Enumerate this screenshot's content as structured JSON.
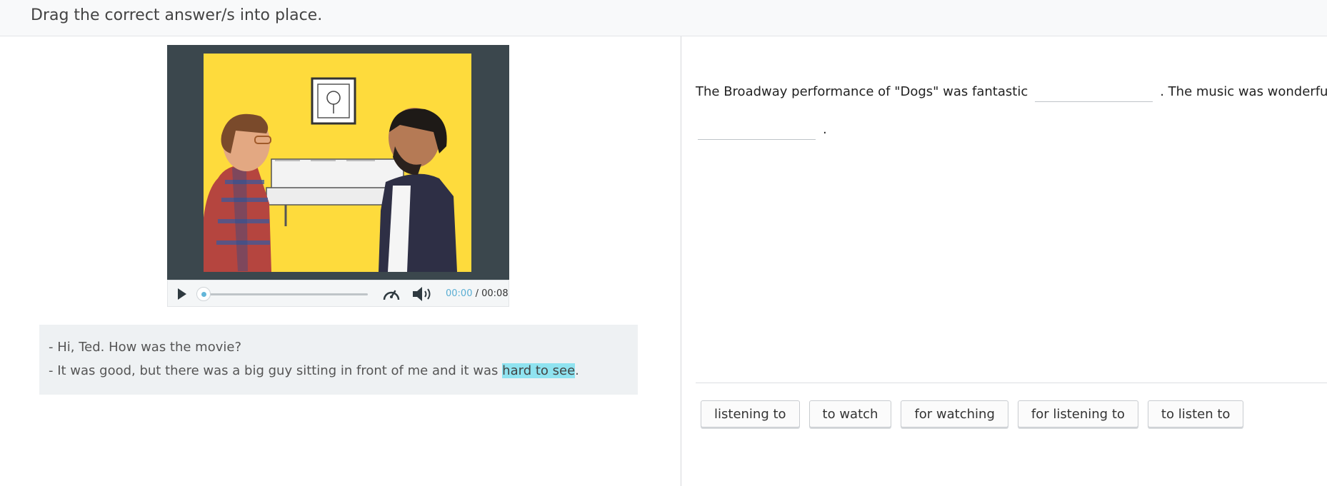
{
  "header": {
    "instruction": "Drag the correct answer/s into place."
  },
  "player": {
    "current_time": "00:00",
    "separator": " / ",
    "duration": "00:08",
    "progress": 0.0
  },
  "transcript": {
    "line1": "- Hi, Ted. How was the movie?",
    "line2_before": "- It was good, but there was a big guy sitting in front of me and it was ",
    "line2_highlight": "hard to see",
    "line2_after": "."
  },
  "question": {
    "part1": "The Broadway performance of \"Dogs\" was fantastic",
    "part2": ". The music was wonderful",
    "part3": "."
  },
  "answers": [
    "listening to",
    "to watch",
    "for watching",
    "for listening to",
    "to listen to"
  ],
  "colors": {
    "scene_bg": "#fedb3c",
    "player_bg": "#3b474d",
    "highlight": "#8fe3f0",
    "time_accent": "#5aaed3"
  },
  "icons": [
    "play-icon",
    "speed-icon",
    "volume-icon"
  ]
}
